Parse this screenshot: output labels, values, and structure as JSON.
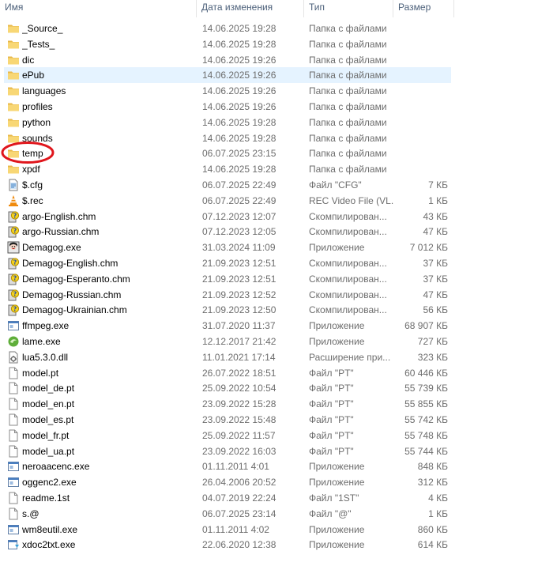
{
  "columns": {
    "name": "Имя",
    "date": "Дата изменения",
    "type": "Тип",
    "size": "Размер"
  },
  "files": [
    {
      "name": "_Source_",
      "date": "14.06.2025 19:28",
      "type": "Папка с файлами",
      "size": "",
      "icon": "folder-icon"
    },
    {
      "name": "_Tests_",
      "date": "14.06.2025 19:28",
      "type": "Папка с файлами",
      "size": "",
      "icon": "folder-icon"
    },
    {
      "name": "dic",
      "date": "14.06.2025 19:26",
      "type": "Папка с файлами",
      "size": "",
      "icon": "folder-icon"
    },
    {
      "name": "ePub",
      "date": "14.06.2025 19:26",
      "type": "Папка с файлами",
      "size": "",
      "icon": "folder-icon",
      "selected": true
    },
    {
      "name": "languages",
      "date": "14.06.2025 19:26",
      "type": "Папка с файлами",
      "size": "",
      "icon": "folder-icon"
    },
    {
      "name": "profiles",
      "date": "14.06.2025 19:26",
      "type": "Папка с файлами",
      "size": "",
      "icon": "folder-icon"
    },
    {
      "name": "python",
      "date": "14.06.2025 19:28",
      "type": "Папка с файлами",
      "size": "",
      "icon": "folder-icon"
    },
    {
      "name": "sounds",
      "date": "14.06.2025 19:28",
      "type": "Папка с файлами",
      "size": "",
      "icon": "folder-icon"
    },
    {
      "name": "temp",
      "date": "06.07.2025 23:15",
      "type": "Папка с файлами",
      "size": "",
      "icon": "folder-icon",
      "circled": true
    },
    {
      "name": "xpdf",
      "date": "14.06.2025 19:28",
      "type": "Папка с файлами",
      "size": "",
      "icon": "folder-icon"
    },
    {
      "name": "$.cfg",
      "date": "06.07.2025 22:49",
      "type": "Файл \"CFG\"",
      "size": "7 КБ",
      "icon": "config-file-icon"
    },
    {
      "name": "$.rec",
      "date": "06.07.2025 22:49",
      "type": "REC Video File (VL...",
      "size": "1 КБ",
      "icon": "vlc-cone-icon"
    },
    {
      "name": "argo-English.chm",
      "date": "07.12.2023 12:07",
      "type": "Скомпилирован...",
      "size": "43 КБ",
      "icon": "chm-help-icon"
    },
    {
      "name": "argo-Russian.chm",
      "date": "07.12.2023 12:05",
      "type": "Скомпилирован...",
      "size": "47 КБ",
      "icon": "chm-help-icon"
    },
    {
      "name": "Demagog.exe",
      "date": "31.03.2024 11:09",
      "type": "Приложение",
      "size": "7 012 КБ",
      "icon": "demagog-app-icon"
    },
    {
      "name": "Demagog-English.chm",
      "date": "21.09.2023 12:51",
      "type": "Скомпилирован...",
      "size": "37 КБ",
      "icon": "chm-help-icon"
    },
    {
      "name": "Demagog-Esperanto.chm",
      "date": "21.09.2023 12:51",
      "type": "Скомпилирован...",
      "size": "37 КБ",
      "icon": "chm-help-icon"
    },
    {
      "name": "Demagog-Russian.chm",
      "date": "21.09.2023 12:52",
      "type": "Скомпилирован...",
      "size": "47 КБ",
      "icon": "chm-help-icon"
    },
    {
      "name": "Demagog-Ukrainian.chm",
      "date": "21.09.2023 12:50",
      "type": "Скомпилирован...",
      "size": "56 КБ",
      "icon": "chm-help-icon"
    },
    {
      "name": "ffmpeg.exe",
      "date": "31.07.2020 11:37",
      "type": "Приложение",
      "size": "68 907 КБ",
      "icon": "exe-window-icon"
    },
    {
      "name": "lame.exe",
      "date": "12.12.2017 21:42",
      "type": "Приложение",
      "size": "727 КБ",
      "icon": "lame-app-icon"
    },
    {
      "name": "lua5.3.0.dll",
      "date": "11.01.2021 17:14",
      "type": "Расширение при...",
      "size": "323 КБ",
      "icon": "dll-gear-icon"
    },
    {
      "name": "model.pt",
      "date": "26.07.2022 18:51",
      "type": "Файл \"PT\"",
      "size": "60 446 КБ",
      "icon": "blank-file-icon"
    },
    {
      "name": "model_de.pt",
      "date": "25.09.2022 10:54",
      "type": "Файл \"PT\"",
      "size": "55 739 КБ",
      "icon": "blank-file-icon"
    },
    {
      "name": "model_en.pt",
      "date": "23.09.2022 15:28",
      "type": "Файл \"PT\"",
      "size": "55 855 КБ",
      "icon": "blank-file-icon"
    },
    {
      "name": "model_es.pt",
      "date": "23.09.2022 15:48",
      "type": "Файл \"PT\"",
      "size": "55 742 КБ",
      "icon": "blank-file-icon"
    },
    {
      "name": "model_fr.pt",
      "date": "25.09.2022 11:57",
      "type": "Файл \"PT\"",
      "size": "55 748 КБ",
      "icon": "blank-file-icon"
    },
    {
      "name": "model_ua.pt",
      "date": "23.09.2022 16:03",
      "type": "Файл \"PT\"",
      "size": "55 744 КБ",
      "icon": "blank-file-icon"
    },
    {
      "name": "neroaacenc.exe",
      "date": "01.11.2011 4:01",
      "type": "Приложение",
      "size": "848 КБ",
      "icon": "exe-window-icon"
    },
    {
      "name": "oggenc2.exe",
      "date": "26.04.2006 20:52",
      "type": "Приложение",
      "size": "312 КБ",
      "icon": "exe-window-icon"
    },
    {
      "name": "readme.1st",
      "date": "04.07.2019 22:24",
      "type": "Файл \"1ST\"",
      "size": "4 КБ",
      "icon": "blank-file-icon"
    },
    {
      "name": "s.@",
      "date": "06.07.2025 23:14",
      "type": "Файл \"@\"",
      "size": "1 КБ",
      "icon": "blank-file-icon"
    },
    {
      "name": "wm8eutil.exe",
      "date": "01.11.2011 4:02",
      "type": "Приложение",
      "size": "860 КБ",
      "icon": "exe-window-icon"
    },
    {
      "name": "xdoc2txt.exe",
      "date": "22.06.2020 12:38",
      "type": "Приложение",
      "size": "614 КБ",
      "icon": "xdoc-app-icon"
    }
  ],
  "colors": {
    "header_text": "#4c607a",
    "secondary_text": "#6d6d6d",
    "selection": "#e5f3ff",
    "folder": "#f8d775",
    "annotation": "#e0161c"
  }
}
